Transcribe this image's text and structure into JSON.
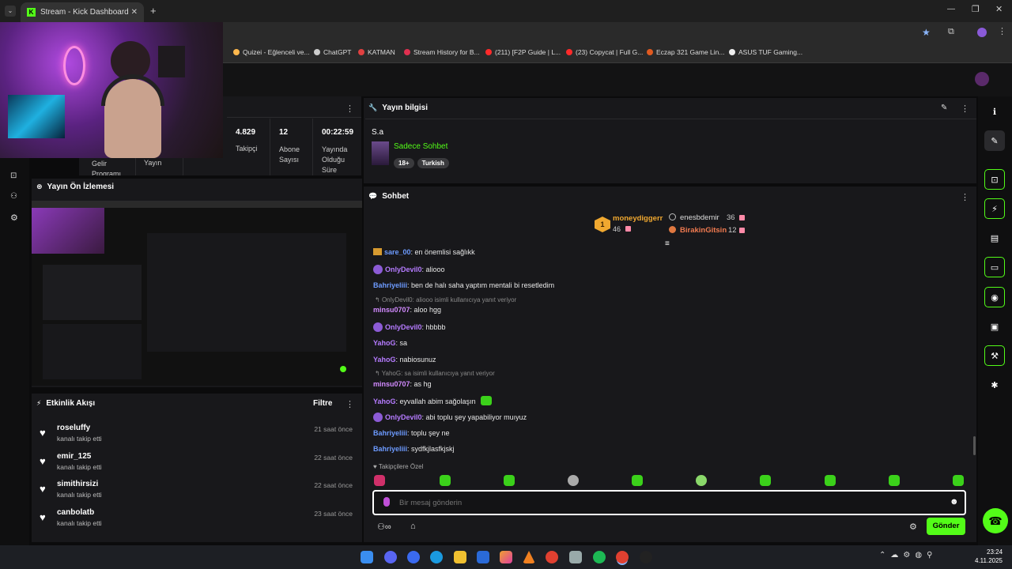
{
  "browser": {
    "tab_title": "Stream - Kick Dashboard",
    "bookmarks": [
      "Quizei - Eğlenceli ve...",
      "ChatGPT",
      "KATMAN",
      "Stream History for B...",
      "(211) [F2P Guide | L...",
      "(23) Copycat | Full G...",
      "Eczap 321 Game Lin...",
      "ASUS TUF Gaming..."
    ]
  },
  "stats": {
    "follower_value": "4.829",
    "follower_label": "Takipçi",
    "subs_value": "12",
    "subs_label": "Abone Sayısı",
    "uptime_value": "00:22:59",
    "uptime_label": "Yayında Olduğu Süre",
    "tab1": "Gelir Programı",
    "tab2": "Yayın"
  },
  "stream_info": {
    "header": "Yayın bilgisi",
    "title": "S.a",
    "category": "Sadece Sohbet",
    "tags": [
      "18+",
      "Turkish"
    ]
  },
  "preview": {
    "header": "Yayın Ön İzlemesi"
  },
  "activity": {
    "header": "Etkinlik Akışı",
    "filter": "Filtre",
    "items": [
      {
        "name": "roseluffy",
        "action": "kanalı takip etti",
        "time": "21 saat önce"
      },
      {
        "name": "emir_125",
        "action": "kanalı takip etti",
        "time": "22 saat önce"
      },
      {
        "name": "simithirsizi",
        "action": "kanalı takip etti",
        "time": "22 saat önce"
      },
      {
        "name": "canbolatb",
        "action": "kanalı takip etti",
        "time": "23 saat önce"
      }
    ]
  },
  "chat": {
    "header": "Sohbet",
    "leaderboard": {
      "rank": "1",
      "first_name": "moneydiggerr",
      "first_count": "46",
      "second_name": "enesbdemir",
      "second_count": "36",
      "third_name": "BirakinGitsin",
      "third_count": "12"
    },
    "messages": [
      {
        "user": "sare_00",
        "text": ": en önemlisi sağlıkk"
      },
      {
        "user": "OnlyDevil0",
        "text": ": aliooo"
      },
      {
        "user": "Bahriyeliii",
        "text": ": ben de halı saha yaptım mentali bi resetledim"
      },
      {
        "reply": "OnlyDevil0: aliooo isimli kullanıcıya yanıt veriyor"
      },
      {
        "user": "minsu0707",
        "text": ": aloo hgg"
      },
      {
        "user": "OnlyDevil0",
        "text": ": hbbbb"
      },
      {
        "user": "YahoG",
        "text": ": sa"
      },
      {
        "user": "YahoG",
        "text": ": nabiosunuz"
      },
      {
        "reply": "YahoG: sa isimli kullanıcıya yanıt veriyor"
      },
      {
        "user": "minsu0707",
        "text": ": as hg"
      },
      {
        "user": "YahoG",
        "text": ": eyvallah abim sağolaşın"
      },
      {
        "user": "OnlyDevil0",
        "text": ": abi toplu şey yapabiliyor muıyuz"
      },
      {
        "user": "Bahriyeliii",
        "text": ": toplu şey ne"
      },
      {
        "user": "Bahriyeliii",
        "text": ": sydfkjlasfkjskj"
      }
    ],
    "followers_only": "Takipçilere Özel",
    "input_placeholder": "Bir mesaj gönderin",
    "send_label": "Gönder"
  },
  "taskbar": {
    "time": "23:24",
    "date": "4.11.2025"
  },
  "colors": {
    "accent": "#53fc18",
    "panel": "#18181b",
    "background": "#0b0b0c"
  }
}
